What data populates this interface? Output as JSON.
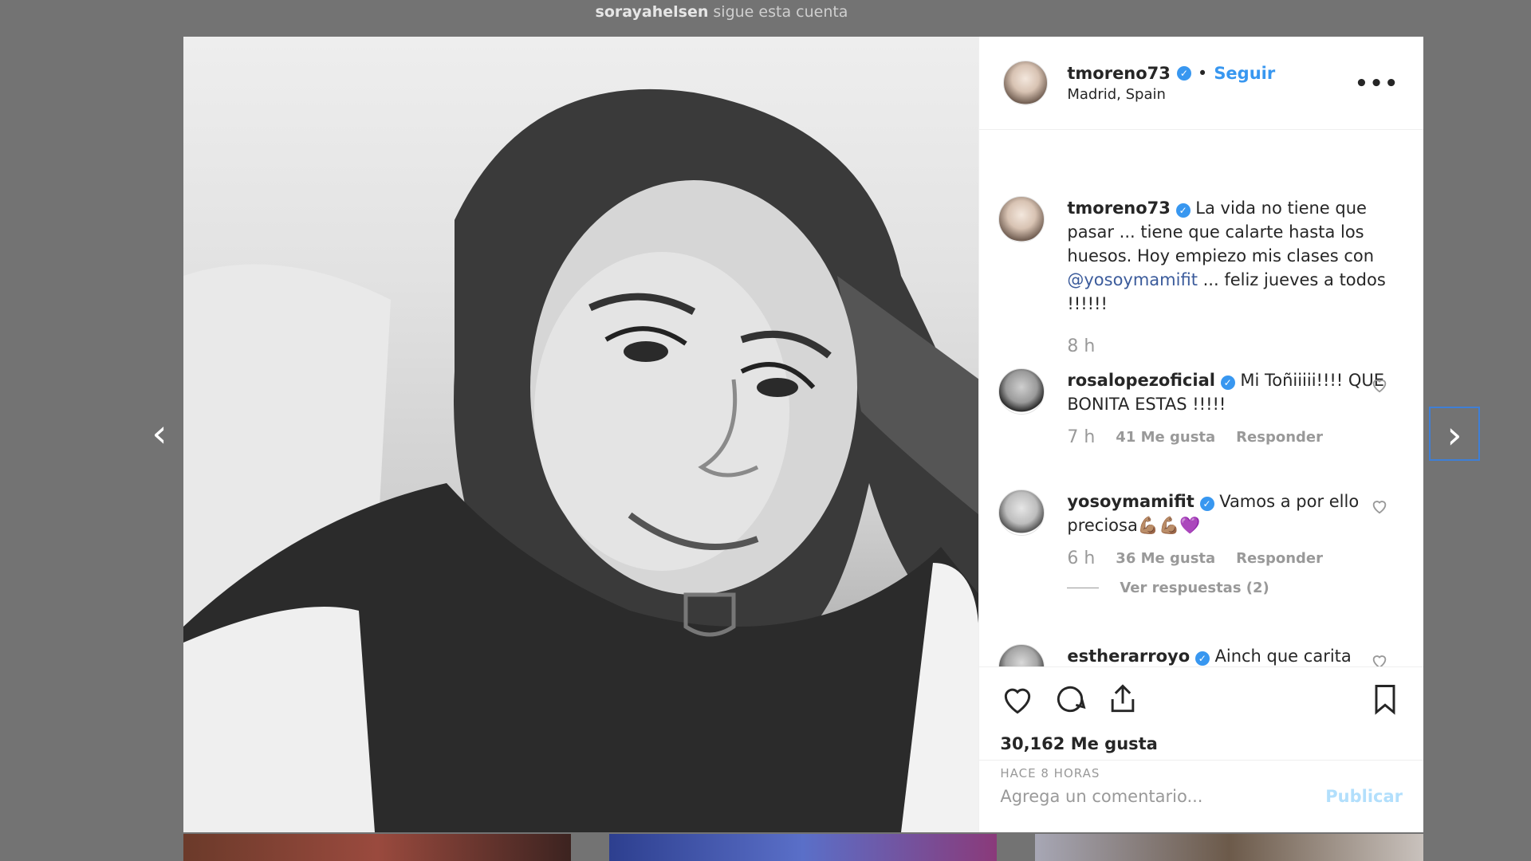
{
  "top_note": {
    "user": "sorayahelsen",
    "text": "sigue esta cuenta"
  },
  "post": {
    "author": "tmoreno73",
    "follow_label": "Seguir",
    "location": "Madrid, Spain",
    "more_label": "•••",
    "caption_before": "La vida no tiene que pasar ... tiene que calarte hasta los huesos. Hoy empiezo mis clases con",
    "caption_mention": "@yosoymamifit",
    "caption_after": "... feliz jueves a todos !!!!!!",
    "caption_time": "8 h"
  },
  "comments": [
    {
      "user": "rosalopezoficial",
      "text": "Mi Toñiiiii!!!! QUE BONITA ESTAS !!!!!",
      "time": "7 h",
      "likes": "41 Me gusta",
      "reply": "Responder"
    },
    {
      "user": "yosoymamifit",
      "text": "Vamos a por ello preciosa💪🏽💪🏽💜",
      "time": "6 h",
      "likes": "36 Me gusta",
      "reply": "Responder",
      "view_replies": "Ver respuestas (2)"
    },
    {
      "user": "estherarroyo",
      "text": "Ainch que carita"
    }
  ],
  "actions": {
    "likes_count": "30,162 Me gusta",
    "posted_ago": "HACE 8 HORAS",
    "comment_placeholder": "Agrega un comentario...",
    "publish_label": "Publicar"
  },
  "nav": {
    "prev": "‹",
    "next": "›"
  },
  "colors": {
    "accent": "#3897f0",
    "overlay": "#737373",
    "muted": "#999999"
  },
  "icons": [
    "heart-icon",
    "comment-icon",
    "share-icon",
    "bookmark-icon",
    "verified-icon",
    "more-icon"
  ]
}
